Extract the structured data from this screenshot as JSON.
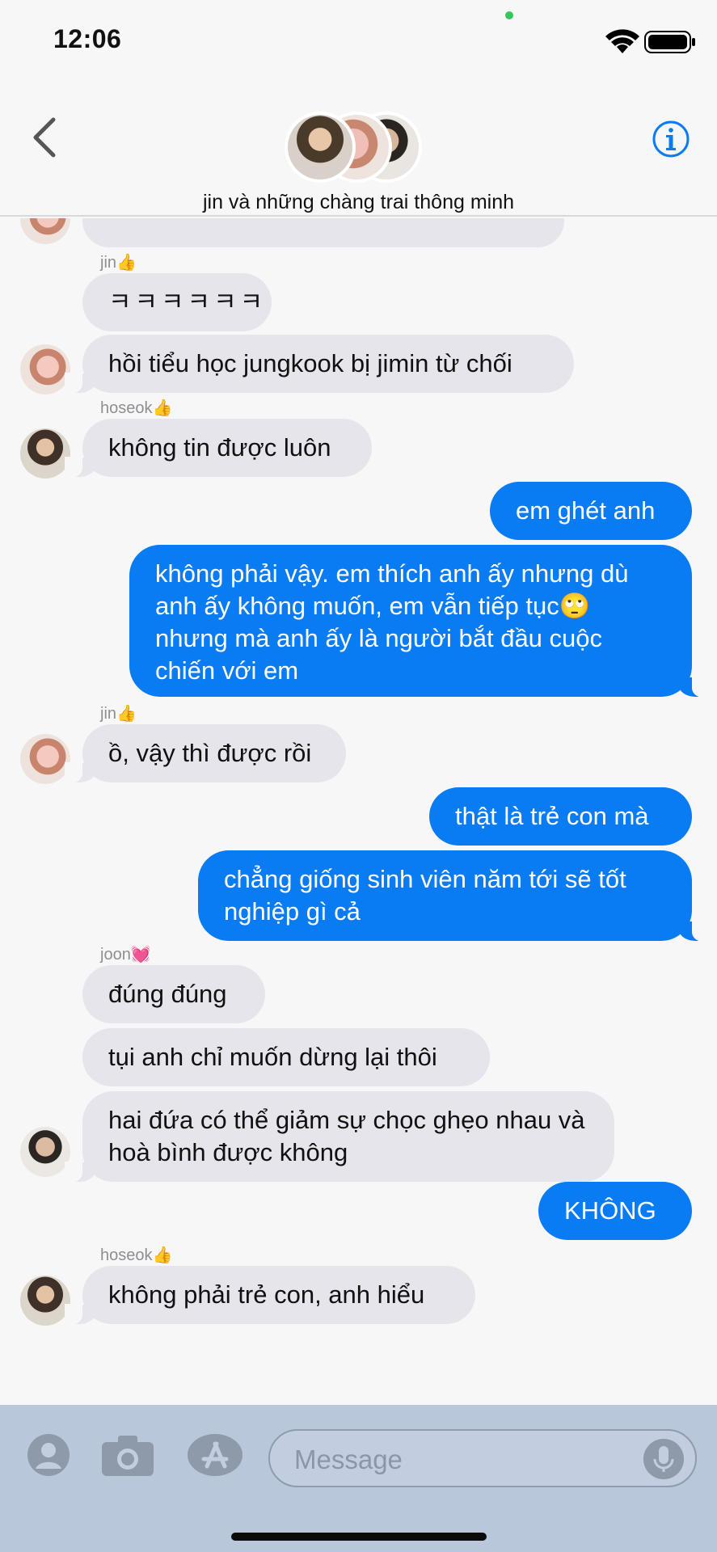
{
  "status": {
    "time": "12:06"
  },
  "header": {
    "title": "jin và những chàng trai thông minh"
  },
  "senders": {
    "jin1": "jin👍",
    "hoseok1": "hoseok👍",
    "jin2": "jin👍",
    "joon": "joon💓",
    "hoseok2": "hoseok👍"
  },
  "messages": {
    "m1": "ㅋㅋㅋㅋㅋㅋ",
    "m2": "hồi tiểu học jungkook bị jimin từ chối",
    "m3": "không tin được luôn",
    "m4": "em ghét anh",
    "m5": "không phải vậy. em thích anh ấy nhưng dù anh ấy không muốn, em vẫn tiếp tục🙄 nhưng mà anh ấy là người bắt đầu cuộc chiến với em",
    "m6": "ồ, vậy thì được rồi",
    "m7": "thật là trẻ con mà",
    "m8": "chẳng giống sinh viên năm tới sẽ tốt nghiệp gì cả",
    "m9": "đúng đúng",
    "m10": "tụi anh chỉ muốn dừng lại thôi",
    "m11": "hai đứa có thể giảm sự chọc ghẹo nhau và hoà bình được không",
    "m12": "KHÔNG",
    "m13": "không phải trẻ con, anh hiểu"
  },
  "composer": {
    "placeholder": "Message"
  },
  "colors": {
    "outgoing": "#0a7cf3",
    "incoming": "#e6e5eb",
    "accent": "#0a7cf3"
  },
  "icons": [
    "back-chevron-icon",
    "info-icon",
    "contact-icon",
    "camera-icon",
    "appstore-icon",
    "mic-icon"
  ]
}
